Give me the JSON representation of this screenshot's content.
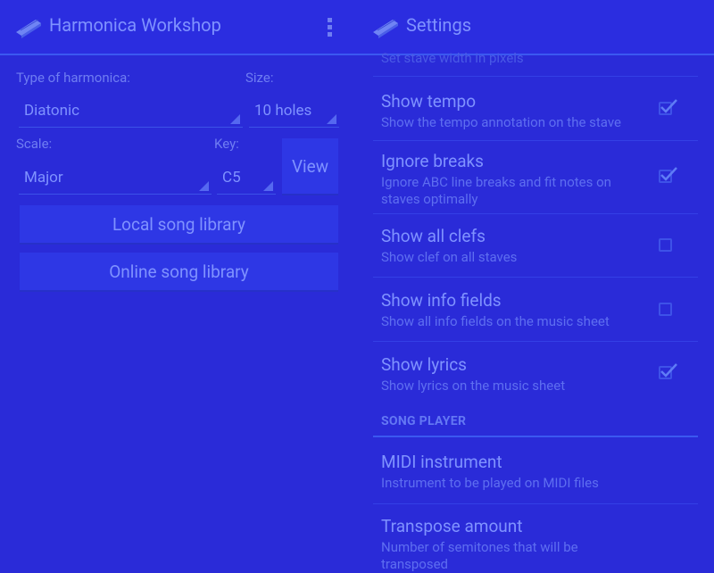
{
  "left": {
    "title": "Harmonica Workshop",
    "type_label": "Type of harmonica:",
    "type_value": "Diatonic",
    "size_label": "Size:",
    "size_value": "10 holes",
    "scale_label": "Scale:",
    "scale_value": "Major",
    "key_label": "Key:",
    "key_value": "C5",
    "view_button": "View",
    "local_library": "Local song library",
    "online_library": "Online song library"
  },
  "right": {
    "title": "Settings",
    "partial_summary": "Set stave width in pixels",
    "prefs": [
      {
        "title": "Show tempo",
        "summary": "Show the tempo annotation on the stave",
        "checked": true
      },
      {
        "title": "Ignore breaks",
        "summary": "Ignore ABC line breaks and fit notes on staves optimally",
        "checked": true
      },
      {
        "title": "Show all clefs",
        "summary": "Show clef on all staves",
        "checked": false
      },
      {
        "title": "Show info fields",
        "summary": "Show all info fields on the music sheet",
        "checked": false
      },
      {
        "title": "Show lyrics",
        "summary": "Show lyrics on the music sheet",
        "checked": true
      }
    ],
    "section_header": "SONG PLAYER",
    "player_prefs": [
      {
        "title": "MIDI instrument",
        "summary": "Instrument to be played on MIDI files"
      },
      {
        "title": "Transpose amount",
        "summary": "Number of semitones that will be transposed"
      }
    ]
  },
  "colors": {
    "background": "#2a2bd8",
    "text": "#7f92ff",
    "secondary_text": "#5e6ef0",
    "accent": "#3b58f0"
  }
}
